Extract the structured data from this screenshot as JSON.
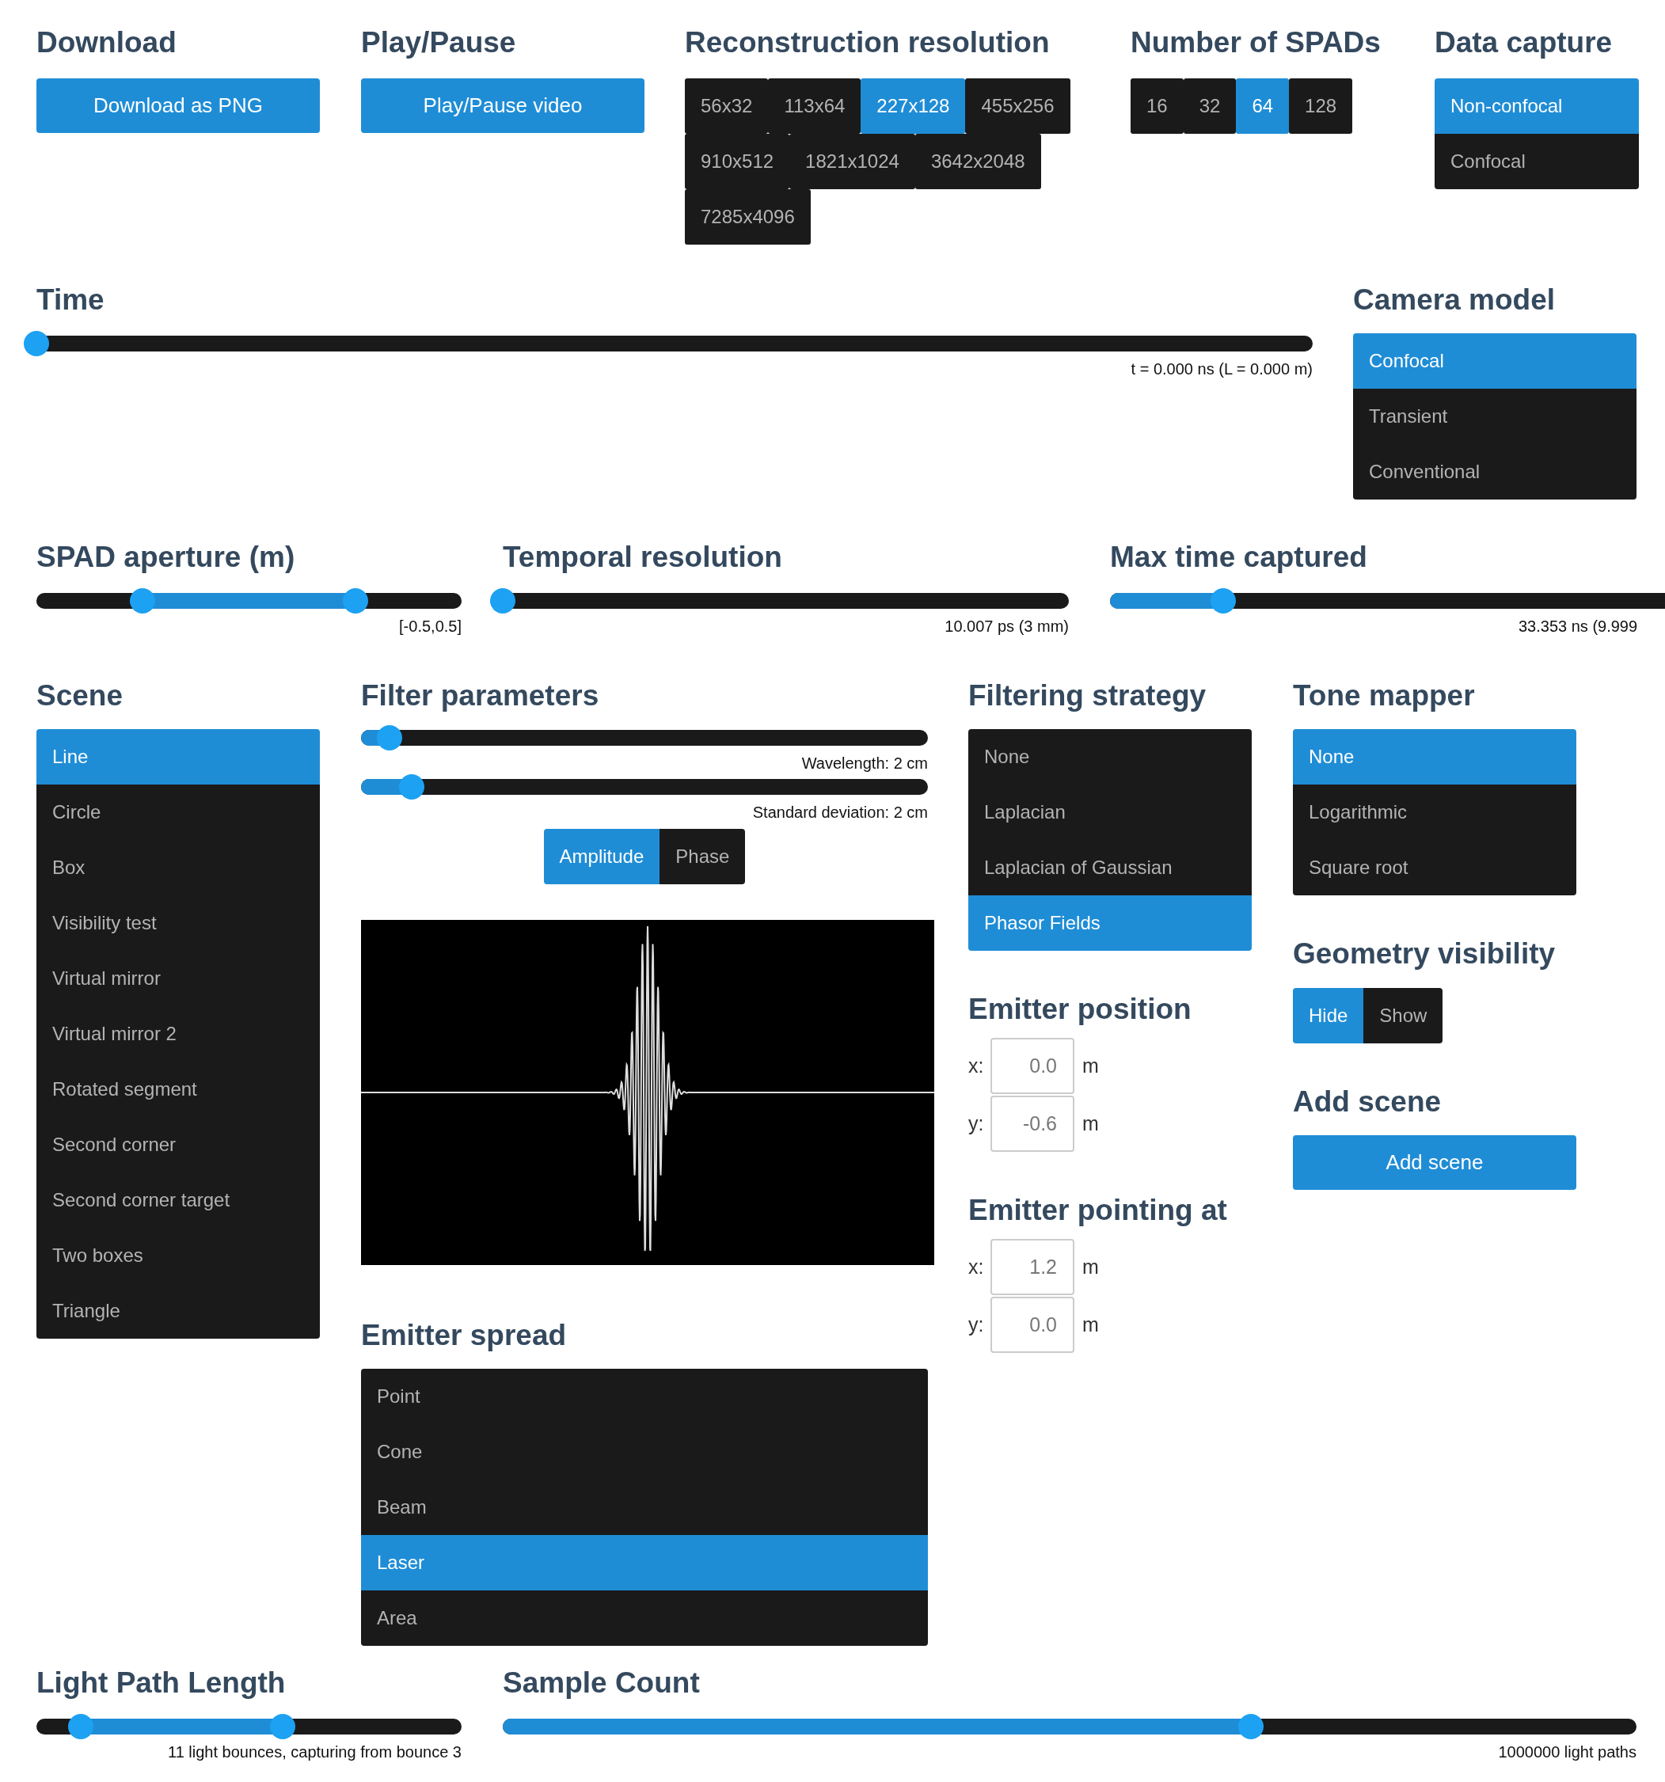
{
  "download": {
    "title": "Download",
    "button": "Download as PNG"
  },
  "play_pause": {
    "title": "Play/Pause",
    "button": "Play/Pause video"
  },
  "reconstruction_resolution": {
    "title": "Reconstruction resolution",
    "options": [
      {
        "label": "56x32",
        "selected": false
      },
      {
        "label": "113x64",
        "selected": false
      },
      {
        "label": "227x128",
        "selected": true
      },
      {
        "label": "455x256",
        "selected": false
      },
      {
        "label": "910x512",
        "selected": false
      },
      {
        "label": "1821x1024",
        "selected": false
      },
      {
        "label": "3642x2048",
        "selected": false
      },
      {
        "label": "7285x4096",
        "selected": false
      }
    ]
  },
  "number_of_spads": {
    "title": "Number of SPADs",
    "options": [
      {
        "label": "16",
        "selected": false
      },
      {
        "label": "32",
        "selected": false
      },
      {
        "label": "64",
        "selected": true
      },
      {
        "label": "128",
        "selected": false
      }
    ]
  },
  "data_capture": {
    "title": "Data capture",
    "options": [
      {
        "label": "Non-confocal",
        "selected": true
      },
      {
        "label": "Confocal",
        "selected": false
      }
    ]
  },
  "time": {
    "title": "Time",
    "thumbs": [
      {
        "level": 0
      }
    ],
    "reading": "t = 0.000 ns (L = 0.000 m)"
  },
  "camera_model": {
    "title": "Camera model",
    "options": [
      {
        "label": "Confocal",
        "selected": true
      },
      {
        "label": "Transient",
        "selected": false
      },
      {
        "label": "Conventional",
        "selected": false
      }
    ]
  },
  "spad_aperture": {
    "title": "SPAD aperture (m)",
    "thumbs": [
      {
        "level": 0.25
      },
      {
        "level": 0.75
      }
    ],
    "reading": "[-0.5,0.5]"
  },
  "temporal_resolution": {
    "title": "Temporal resolution",
    "thumbs": [
      {
        "level": 0
      }
    ],
    "reading": "10.007 ps (3 mm)"
  },
  "max_time_captured": {
    "title": "Max time captured",
    "thumbs": [
      {
        "level": 0.2
      }
    ],
    "reading": "33.353 ns (9.999"
  },
  "scene": {
    "title": "Scene",
    "options": [
      {
        "label": "Line",
        "selected": true
      },
      {
        "label": "Circle",
        "selected": false
      },
      {
        "label": "Box",
        "selected": false
      },
      {
        "label": "Visibility test",
        "selected": false
      },
      {
        "label": "Virtual mirror",
        "selected": false
      },
      {
        "label": "Virtual mirror 2",
        "selected": false
      },
      {
        "label": "Rotated segment",
        "selected": false
      },
      {
        "label": "Second corner",
        "selected": false
      },
      {
        "label": "Second corner target",
        "selected": false
      },
      {
        "label": "Two boxes",
        "selected": false
      },
      {
        "label": "Triangle",
        "selected": false
      }
    ]
  },
  "filter_parameters": {
    "title": "Filter parameters",
    "sliders": [
      {
        "thumbs": [
          {
            "level": 0.05
          }
        ],
        "reading": "Wavelength: 2 cm"
      },
      {
        "thumbs": [
          {
            "level": 0.09
          }
        ],
        "reading": "Standard deviation: 2 cm"
      }
    ],
    "view": [
      {
        "label": "Amplitude",
        "selected": true
      },
      {
        "label": "Phase",
        "selected": false
      }
    ]
  },
  "emitter_spread": {
    "title": "Emitter spread",
    "options": [
      {
        "label": "Point",
        "selected": false
      },
      {
        "label": "Cone",
        "selected": false
      },
      {
        "label": "Beam",
        "selected": false
      },
      {
        "label": "Laser",
        "selected": true
      },
      {
        "label": "Area",
        "selected": false
      }
    ]
  },
  "filtering_strategy": {
    "title": "Filtering strategy",
    "options": [
      {
        "label": "None",
        "selected": false
      },
      {
        "label": "Laplacian",
        "selected": false
      },
      {
        "label": "Laplacian of Gaussian",
        "selected": false
      },
      {
        "label": "Phasor Fields",
        "selected": true
      }
    ]
  },
  "emitter_position": {
    "title": "Emitter position",
    "fields": [
      {
        "label": "x:",
        "value": "0.0",
        "unit": "m"
      },
      {
        "label": "y:",
        "value": "-0.6",
        "unit": "m"
      }
    ]
  },
  "emitter_pointing_at": {
    "title": "Emitter pointing at",
    "fields": [
      {
        "label": "x:",
        "value": "1.2",
        "unit": "m"
      },
      {
        "label": "y:",
        "value": "0.0",
        "unit": "m"
      }
    ]
  },
  "tone_mapper": {
    "title": "Tone mapper",
    "options": [
      {
        "label": "None",
        "selected": true
      },
      {
        "label": "Logarithmic",
        "selected": false
      },
      {
        "label": "Square root",
        "selected": false
      }
    ]
  },
  "geometry_visibility": {
    "title": "Geometry visibility",
    "options": [
      {
        "label": "Hide",
        "selected": true
      },
      {
        "label": "Show",
        "selected": false
      }
    ]
  },
  "add_scene": {
    "title": "Add scene",
    "button": "Add scene"
  },
  "light_path_length": {
    "title": "Light Path Length",
    "thumbs": [
      {
        "level": 0.104
      },
      {
        "level": 0.58
      }
    ],
    "reading": "11 light bounces, capturing from bounce 3"
  },
  "sample_count": {
    "title": "Sample Count",
    "thumbs": [
      {
        "level": 0.66
      }
    ],
    "reading": "1000000 light paths"
  }
}
